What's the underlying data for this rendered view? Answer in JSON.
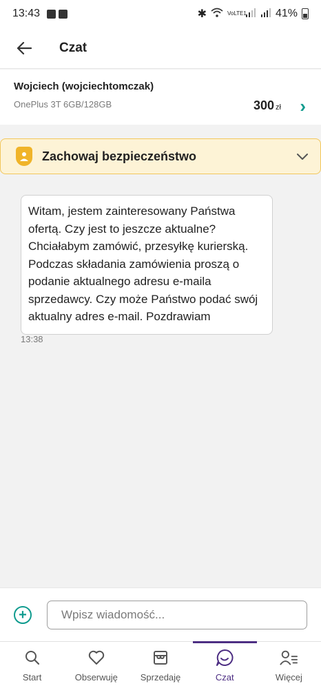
{
  "status_bar": {
    "time": "13:43",
    "network": "VoLTE1",
    "battery": "41%"
  },
  "app_bar": {
    "title": "Czat"
  },
  "listing": {
    "seller": "Wojciech (wojciechtomczak)",
    "product": "OnePlus 3T 6GB/128GB",
    "price": "300",
    "currency": "zł"
  },
  "safety": {
    "label": "Zachowaj bezpieczeństwo"
  },
  "message": {
    "text": "Witam, jestem zainteresowany Państwa ofertą. Czy jest to jeszcze aktualne? Chciałabym zamówić, przesyłkę kurierską. Podczas składania zamówienia proszą o podanie aktualnego adresu e-maila sprzedawcy. Czy może Państwo podać swój aktualny adres e-mail. Pozdrawiam",
    "time": "13:38"
  },
  "composer": {
    "placeholder": "Wpisz wiadomość..."
  },
  "bottom_nav": {
    "items": [
      {
        "label": "Start",
        "icon": "search-icon"
      },
      {
        "label": "Obserwuję",
        "icon": "heart-icon"
      },
      {
        "label": "Sprzedaję",
        "icon": "store-icon"
      },
      {
        "label": "Czat",
        "icon": "chat-icon"
      },
      {
        "label": "Więcej",
        "icon": "user-list-icon"
      }
    ],
    "active_index": 3
  },
  "colors": {
    "accent": "#0f9b8e",
    "brand": "#4d2e83",
    "safety_bg": "#fdf3d6",
    "safety_border": "#f2c65a"
  }
}
